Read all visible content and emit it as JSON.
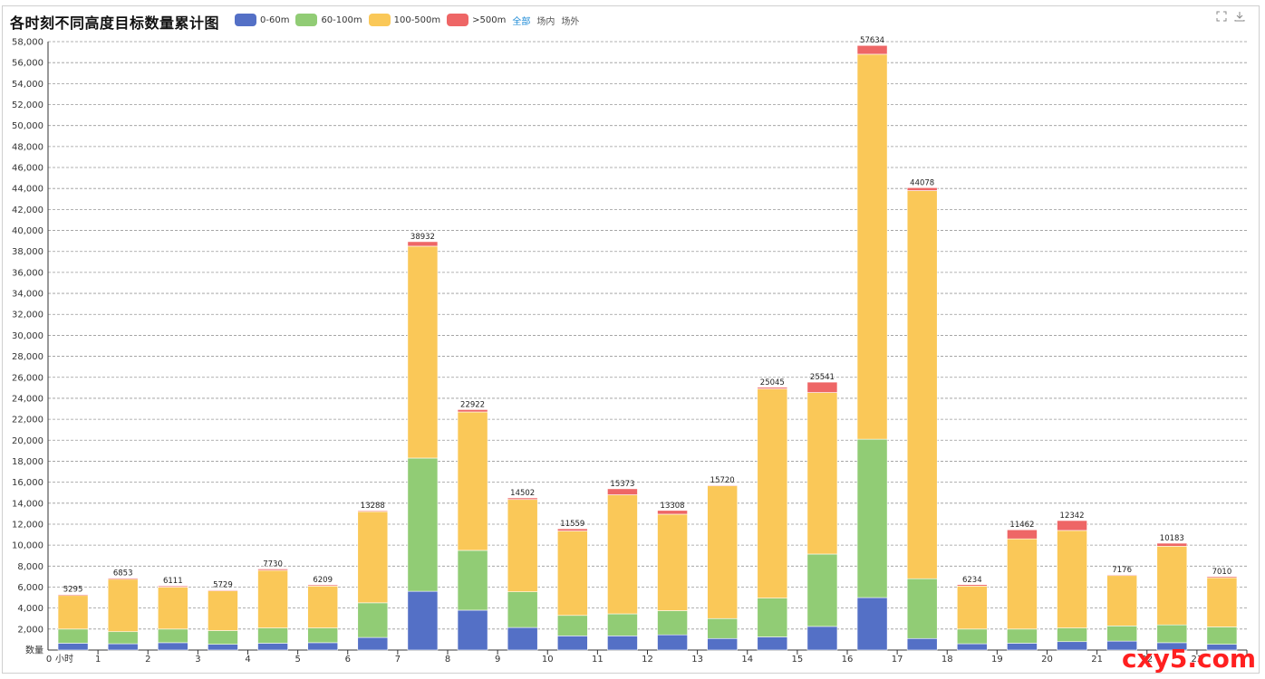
{
  "chart_data": {
    "type": "bar",
    "stacked": true,
    "title": "各时刻不同高度目标数量累计图",
    "xlabel": "小时",
    "ylabel": "数量",
    "ylim": [
      0,
      58000
    ],
    "ytick_step": 2000,
    "grid": true,
    "legend_position": "top-left",
    "categories": [
      "0",
      "1",
      "2",
      "3",
      "4",
      "5",
      "6",
      "7",
      "8",
      "9",
      "10",
      "11",
      "12",
      "13",
      "14",
      "15",
      "16",
      "17",
      "18",
      "19",
      "20",
      "21",
      "22",
      "23"
    ],
    "series": [
      {
        "name": "0-60m",
        "color": "#5470c6",
        "values": [
          650,
          600,
          700,
          550,
          650,
          700,
          1200,
          5600,
          3800,
          2150,
          1350,
          1350,
          1450,
          1100,
          1250,
          2250,
          5000,
          1100,
          600,
          650,
          800,
          850,
          700,
          550
        ]
      },
      {
        "name": "60-100m",
        "color": "#91cc75",
        "values": [
          1350,
          1150,
          1300,
          1300,
          1450,
          1400,
          3300,
          12700,
          5700,
          3400,
          1950,
          2100,
          2300,
          1900,
          3700,
          6900,
          15100,
          5700,
          1400,
          1350,
          1300,
          1450,
          1700,
          1650
        ]
      },
      {
        "name": "100-500m",
        "color": "#fac858",
        "values": [
          3200,
          5000,
          4000,
          3800,
          5500,
          4000,
          8700,
          20200,
          13200,
          8800,
          8050,
          11350,
          9200,
          12650,
          19950,
          15400,
          36700,
          37000,
          4100,
          8600,
          9300,
          4800,
          7500,
          4700
        ]
      },
      {
        "name": ">500m",
        "color": "#ee6666",
        "values": [
          95,
          103,
          111,
          79,
          130,
          109,
          88,
          432,
          222,
          152,
          209,
          573,
          358,
          70,
          145,
          991,
          834,
          278,
          134,
          862,
          942,
          76,
          283,
          110
        ]
      }
    ],
    "totals": [
      5295,
      6853,
      6111,
      5729,
      7730,
      6209,
      13288,
      38932,
      22922,
      14502,
      11559,
      15373,
      13308,
      15720,
      25045,
      25541,
      57634,
      44078,
      6234,
      11462,
      12342,
      7176,
      10183,
      7010
    ]
  },
  "filters": {
    "all": "全部",
    "inside": "场内",
    "outside": "场外"
  },
  "toolbox": {
    "fullscreen_icon": "fullscreen-icon",
    "download_icon": "download-icon"
  },
  "watermark": "cxy5.com"
}
